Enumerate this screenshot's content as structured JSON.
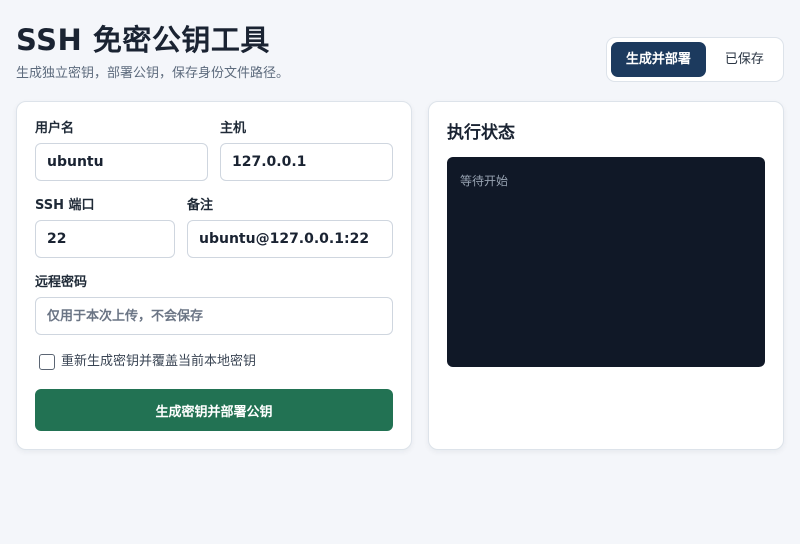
{
  "header": {
    "title": "SSH 免密公钥工具",
    "subtitle": "生成独立密钥，部署公钥，保存身份文件路径。"
  },
  "tabs": [
    {
      "label": "生成并部署",
      "active": true
    },
    {
      "label": "已保存",
      "active": false
    }
  ],
  "form": {
    "username": {
      "label": "用户名",
      "value": "ubuntu"
    },
    "host": {
      "label": "主机",
      "value": "127.0.0.1"
    },
    "port": {
      "label": "SSH 端口",
      "value": "22"
    },
    "note": {
      "label": "备注",
      "value": "ubuntu@127.0.0.1:22"
    },
    "password": {
      "label": "远程密码",
      "value": "",
      "placeholder": "仅用于本次上传，不会保存"
    },
    "regenerate": {
      "label": "重新生成密钥并覆盖当前本地密钥",
      "checked": false
    },
    "submit_label": "生成密钥并部署公钥"
  },
  "status": {
    "title": "执行状态",
    "log": "等待开始"
  },
  "colors": {
    "accent_tab": "#1c3a5e",
    "primary_button": "#227253",
    "console_bg": "#101827"
  }
}
